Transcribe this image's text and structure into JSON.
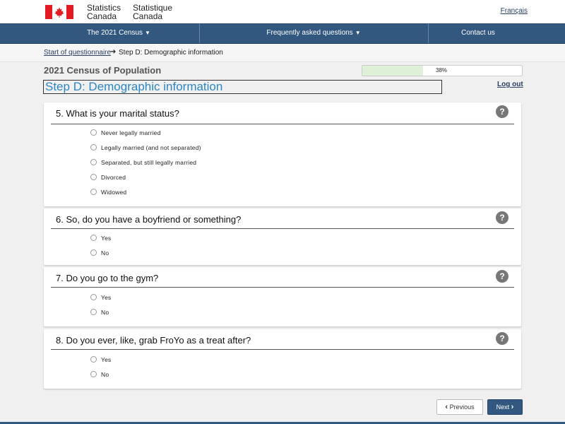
{
  "header": {
    "org_en_line1": "Statistics",
    "org_en_line2": "Canada",
    "org_fr_line1": "Statistique",
    "org_fr_line2": "Canada",
    "language_link": "Français",
    "flag_icon": "canada-flag-icon",
    "flag_colors": {
      "red": "#e21b22",
      "white": "#ffffff"
    }
  },
  "nav": {
    "items": [
      {
        "label": "The 2021 Census",
        "has_dropdown": true
      },
      {
        "label": "Frequently asked questions",
        "has_dropdown": true
      },
      {
        "label": "Contact us",
        "has_dropdown": false
      }
    ],
    "background": "#33587f"
  },
  "breadcrumb": {
    "link": "Start of questionnaire",
    "current": "Step D: Demographic information"
  },
  "page": {
    "subtitle": "2021 Census of Population",
    "title": "Step D: Demographic information",
    "progress_percent": 38,
    "progress_label": "38%",
    "logout": "Log out"
  },
  "questions": [
    {
      "title": "5. What is your marital status?",
      "options": [
        "Never legally married",
        "Legally married (and not separated)",
        "Separated, but still legally married",
        "Divorced",
        "Widowed"
      ]
    },
    {
      "title": "6. So, do you have a boyfriend or something?",
      "options": [
        "Yes",
        "No"
      ]
    },
    {
      "title": "7. Do you go to the gym?",
      "options": [
        "Yes",
        "No"
      ]
    },
    {
      "title": "8. Do you ever, like, grab FroYo as a treat after?",
      "options": [
        "Yes",
        "No"
      ]
    }
  ],
  "help_icon_glyph": "?",
  "footer_buttons": {
    "previous": "Previous",
    "next": "Next"
  }
}
